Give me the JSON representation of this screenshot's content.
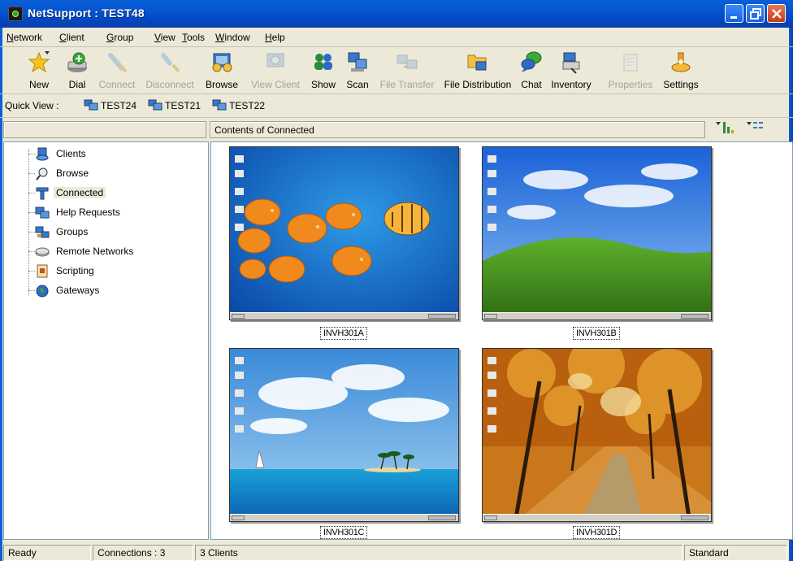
{
  "window": {
    "title": "NetSupport : TEST48",
    "controls": {
      "minimize": "minimize-icon",
      "restore": "restore-icon",
      "close": "close-icon"
    }
  },
  "menu": [
    {
      "label": "Network",
      "underline": "N"
    },
    {
      "label": "Client",
      "underline": "C"
    },
    {
      "label": "Group",
      "underline": "G"
    },
    {
      "label": "View",
      "underline": "V"
    },
    {
      "label": "Tools",
      "underline": "T"
    },
    {
      "label": "Window",
      "underline": "W"
    },
    {
      "label": "Help",
      "underline": "H"
    }
  ],
  "toolbar": [
    {
      "label": "New",
      "icon": "new-star-icon",
      "enabled": true
    },
    {
      "label": "Dial",
      "icon": "dial-modem-icon",
      "enabled": true
    },
    {
      "label": "Connect",
      "icon": "connect-plug-icon",
      "enabled": false
    },
    {
      "label": "Disconnect",
      "icon": "disconnect-plug-icon",
      "enabled": false
    },
    {
      "label": "Browse",
      "icon": "browse-icon",
      "enabled": true
    },
    {
      "label": "View Client",
      "icon": "view-client-icon",
      "enabled": false
    },
    {
      "label": "Show",
      "icon": "show-users-icon",
      "enabled": true
    },
    {
      "label": "Scan",
      "icon": "scan-icon",
      "enabled": true
    },
    {
      "label": "File Transfer",
      "icon": "file-transfer-icon",
      "enabled": false
    },
    {
      "label": "File Distribution",
      "icon": "file-distribution-icon",
      "enabled": true
    },
    {
      "label": "Chat",
      "icon": "chat-icon",
      "enabled": true
    },
    {
      "label": "Inventory",
      "icon": "inventory-icon",
      "enabled": true
    },
    {
      "label": "Properties",
      "icon": "properties-icon",
      "enabled": false
    },
    {
      "label": "Settings",
      "icon": "settings-icon",
      "enabled": true
    }
  ],
  "quick_view": {
    "label": "Quick View :",
    "items": [
      "TEST24",
      "TEST21",
      "TEST22"
    ]
  },
  "pane_header": {
    "left": "",
    "right": "Contents of Connected"
  },
  "tree": [
    {
      "label": "Clients",
      "icon": "clients-icon",
      "selected": false
    },
    {
      "label": "Browse",
      "icon": "browse-magnifier-icon",
      "selected": false
    },
    {
      "label": "Connected",
      "icon": "connected-icon",
      "selected": true
    },
    {
      "label": "Help Requests",
      "icon": "help-requests-icon",
      "selected": false
    },
    {
      "label": "Groups",
      "icon": "groups-icon",
      "selected": false
    },
    {
      "label": "Remote Networks",
      "icon": "remote-networks-icon",
      "selected": false
    },
    {
      "label": "Scripting",
      "icon": "scripting-icon",
      "selected": false
    },
    {
      "label": "Gateways",
      "icon": "gateways-globe-icon",
      "selected": false
    }
  ],
  "clients": [
    {
      "name": "INVH301A",
      "wallpaper": "fish"
    },
    {
      "name": "INVH301B",
      "wallpaper": "bliss"
    },
    {
      "name": "INVH301C",
      "wallpaper": "beach"
    },
    {
      "name": "INVH301D",
      "wallpaper": "autumn"
    }
  ],
  "status": {
    "state": "Ready",
    "connections": "Connections : 3",
    "clients": "3 Clients",
    "mode": "Standard"
  },
  "colors": {
    "titlebar": "#0a5fd6",
    "face": "#ece9d8",
    "pane_border": "#7f9db9"
  }
}
